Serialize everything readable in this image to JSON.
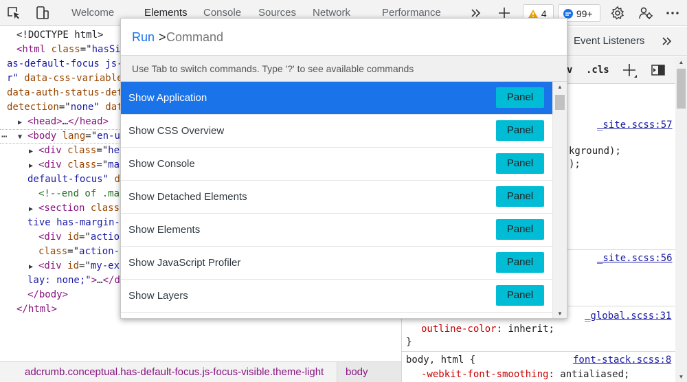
{
  "toolbar": {
    "tabs": [
      {
        "label": "Welcome"
      },
      {
        "label": "Elements"
      },
      {
        "label": "Console"
      },
      {
        "label": "Sources"
      },
      {
        "label": "Network"
      },
      {
        "label": "Performance"
      }
    ],
    "warnings_count": "4",
    "messages_count": "99+",
    "accent_color": "#1a73e8",
    "icons": [
      "inspect-icon",
      "device-emulation-icon",
      "more-tabs-icon",
      "add-tab-icon",
      "warning-icon",
      "message-icon",
      "settings-icon",
      "customize-icon",
      "more-options-icon"
    ]
  },
  "tree": {
    "lines": [
      {
        "parts": [
          [
            "tx",
            "<!DOCTYPE html>"
          ]
        ]
      },
      {
        "parts": [
          [
            "tag",
            "<html "
          ],
          [
            "at",
            "class"
          ],
          [
            "tx",
            "=\""
          ],
          [
            "av",
            "hasSi"
          ]
        ]
      },
      {
        "parts": [
          [
            "av",
            "as-default-focus js-"
          ]
        ]
      },
      {
        "parts": [
          [
            "av",
            "r\" "
          ],
          [
            "at",
            "data-css-variable"
          ]
        ]
      },
      {
        "parts": [
          [
            "at",
            "data-auth-status-det"
          ]
        ]
      },
      {
        "parts": [
          [
            "at",
            "detection"
          ],
          [
            "tx",
            "=\""
          ],
          [
            "av",
            "none"
          ],
          [
            "tx",
            "\" "
          ],
          [
            "at",
            "dat"
          ]
        ]
      },
      {
        "parts": [
          [
            "tag",
            "<head>"
          ],
          [
            "tx",
            "…"
          ],
          [
            "tag",
            "</head>"
          ]
        ]
      },
      {
        "parts": [
          [
            "tag",
            "<body "
          ],
          [
            "at",
            "lang"
          ],
          [
            "tx",
            "=\""
          ],
          [
            "av",
            "en-u"
          ]
        ]
      },
      {
        "parts": [
          [
            "tag",
            "<div "
          ],
          [
            "at",
            "class"
          ],
          [
            "tx",
            "=\""
          ],
          [
            "av",
            "he"
          ]
        ]
      },
      {
        "parts": [
          [
            "tag",
            "<div "
          ],
          [
            "at",
            "class"
          ],
          [
            "tx",
            "=\""
          ],
          [
            "av",
            "ma"
          ]
        ]
      },
      {
        "parts": [
          [
            "av",
            "default-focus\" "
          ],
          [
            "at",
            "d"
          ]
        ]
      },
      {
        "parts": [
          [
            "cm",
            "<!--end of .ma"
          ]
        ]
      },
      {
        "parts": [
          [
            "tag",
            "<section "
          ],
          [
            "at",
            "class"
          ]
        ]
      },
      {
        "parts": [
          [
            "av",
            "tive has-margin-"
          ]
        ]
      },
      {
        "parts": [
          [
            "tag",
            "<div "
          ],
          [
            "at",
            "id"
          ],
          [
            "tx",
            "=\""
          ],
          [
            "av",
            "actio"
          ]
        ]
      },
      {
        "parts": [
          [
            "at",
            "class"
          ],
          [
            "tx",
            "=\""
          ],
          [
            "av",
            "action-"
          ]
        ]
      },
      {
        "parts": [
          [
            "tag",
            "<div "
          ],
          [
            "at",
            "id"
          ],
          [
            "tx",
            "=\""
          ],
          [
            "av",
            "my-ext"
          ]
        ]
      },
      {
        "parts": [
          [
            "av",
            "lay: none;\""
          ],
          [
            "tag",
            ">"
          ],
          [
            "tx",
            "…"
          ],
          [
            "tag",
            "</d"
          ]
        ]
      },
      {
        "parts": [
          [
            "tag",
            "</body>"
          ]
        ]
      },
      {
        "parts": [
          [
            "tag",
            "</html>"
          ]
        ]
      }
    ]
  },
  "breadcrumb": {
    "path": "adcrumb.conceptual.has-default-focus.js-focus-visible.theme-light",
    "current": "body"
  },
  "styles": {
    "subtab_label": "Event Listeners",
    "filter_v": "v",
    "cls_label": ".cls",
    "sources": [
      "_site.scss:57",
      "_site.scss:56",
      "_global.scss:31",
      "font-stack.scss:8"
    ],
    "snippet_1": "kground);",
    "snippet_2": ");",
    "outline_prop": "outline-color",
    "outline_val": "inherit",
    "close_brace": "}",
    "selector": "body, html {",
    "smoothing_prop": "-webkit-font-smoothing",
    "smoothing_val": "antialiased"
  },
  "command_menu": {
    "prefix": "Run",
    "prompt": ">",
    "placeholder": "Command",
    "hint": "Use Tab to switch commands. Type '?' to see available commands",
    "items": [
      {
        "label": "Show Application",
        "tag": "Panel",
        "selected": true
      },
      {
        "label": "Show CSS Overview",
        "tag": "Panel"
      },
      {
        "label": "Show Console",
        "tag": "Panel"
      },
      {
        "label": "Show Detached Elements",
        "tag": "Panel"
      },
      {
        "label": "Show Elements",
        "tag": "Panel"
      },
      {
        "label": "Show JavaScript Profiler",
        "tag": "Panel"
      },
      {
        "label": "Show Layers",
        "tag": "Panel"
      }
    ],
    "tag_color": "#00bcd4",
    "selected_color": "#1a73e8"
  }
}
